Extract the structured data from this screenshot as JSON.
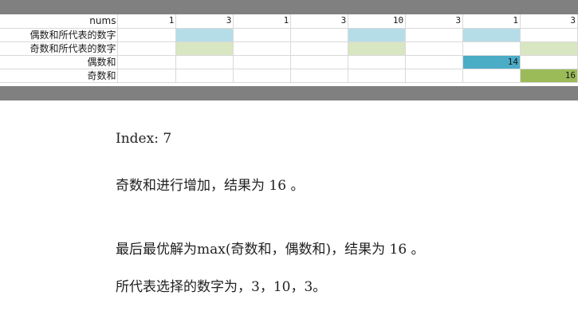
{
  "sheet": {
    "rows": [
      {
        "label": "nums",
        "cells": [
          {
            "text": "1",
            "fill": ""
          },
          {
            "text": "3",
            "fill": ""
          },
          {
            "text": "1",
            "fill": ""
          },
          {
            "text": "3",
            "fill": ""
          },
          {
            "text": "10",
            "fill": ""
          },
          {
            "text": "3",
            "fill": ""
          },
          {
            "text": "1",
            "fill": ""
          },
          {
            "text": "3",
            "fill": ""
          }
        ]
      },
      {
        "label": "偶数和所代表的数字",
        "cells": [
          {
            "text": "",
            "fill": ""
          },
          {
            "text": "",
            "fill": "#b5dde8"
          },
          {
            "text": "",
            "fill": ""
          },
          {
            "text": "",
            "fill": ""
          },
          {
            "text": "",
            "fill": "#b5dde8"
          },
          {
            "text": "",
            "fill": ""
          },
          {
            "text": "",
            "fill": "#b5dde8"
          },
          {
            "text": "",
            "fill": ""
          }
        ]
      },
      {
        "label": "奇数和所代表的数字",
        "cells": [
          {
            "text": "",
            "fill": ""
          },
          {
            "text": "",
            "fill": "#d8e6c2"
          },
          {
            "text": "",
            "fill": ""
          },
          {
            "text": "",
            "fill": ""
          },
          {
            "text": "",
            "fill": "#d8e6c2"
          },
          {
            "text": "",
            "fill": ""
          },
          {
            "text": "",
            "fill": ""
          },
          {
            "text": "",
            "fill": "#d8e6c2"
          }
        ]
      },
      {
        "label": "偶数和",
        "cells": [
          {
            "text": "",
            "fill": ""
          },
          {
            "text": "",
            "fill": ""
          },
          {
            "text": "",
            "fill": ""
          },
          {
            "text": "",
            "fill": ""
          },
          {
            "text": "",
            "fill": ""
          },
          {
            "text": "",
            "fill": ""
          },
          {
            "text": "14",
            "fill": "#4bacc6"
          },
          {
            "text": "",
            "fill": ""
          }
        ]
      },
      {
        "label": "奇数和",
        "cells": [
          {
            "text": "",
            "fill": ""
          },
          {
            "text": "",
            "fill": ""
          },
          {
            "text": "",
            "fill": ""
          },
          {
            "text": "",
            "fill": ""
          },
          {
            "text": "",
            "fill": ""
          },
          {
            "text": "",
            "fill": ""
          },
          {
            "text": "",
            "fill": ""
          },
          {
            "text": "16",
            "fill": "#9bbb59"
          }
        ]
      }
    ]
  },
  "explanation": {
    "index_line": "Index: 7",
    "odd_sum_line": "奇数和进行增加，结果为 16 。",
    "max_line": "最后最优解为max(奇数和，偶数和)，结果为 16 。",
    "selection_line": "所代表选择的数字为，3，10，3。"
  }
}
